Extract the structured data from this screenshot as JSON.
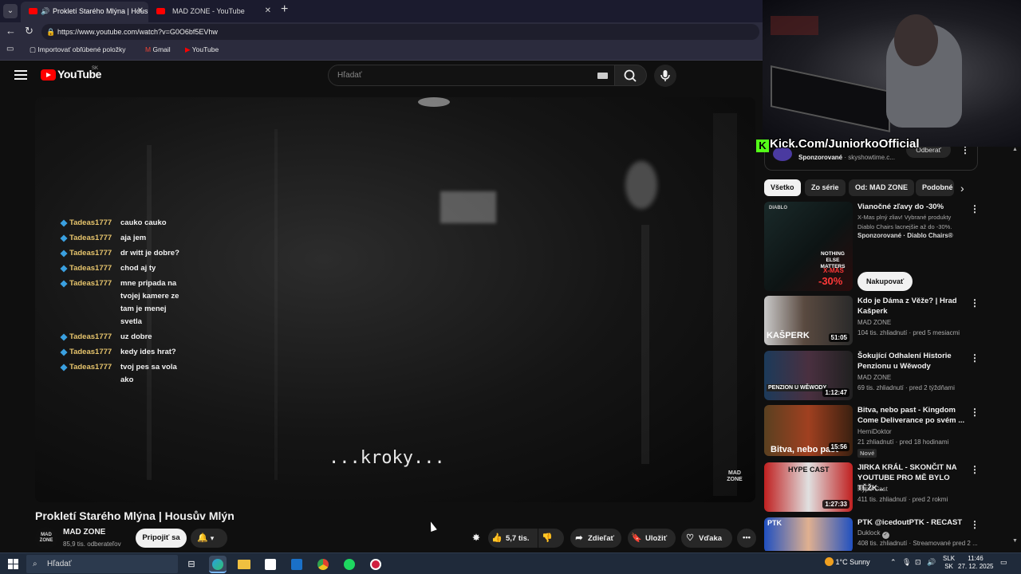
{
  "browser": {
    "tabs": [
      {
        "label": "Prokletí Starého Mlýna | Housů",
        "active": true
      },
      {
        "label": "MAD ZONE - YouTube",
        "active": false
      }
    ],
    "url": "https://www.youtube.com/watch?v=G0O6bf5EVhw",
    "bookmarks": [
      "Importovať obľúbené položky",
      "Gmail",
      "YouTube"
    ]
  },
  "youtube": {
    "logo": "YouTube",
    "region": "SK",
    "search_placeholder": "Hľadať"
  },
  "player": {
    "chat": [
      {
        "user": "Tadeas1777",
        "msg": "cauko cauko"
      },
      {
        "user": "Tadeas1777",
        "msg": "aja jem"
      },
      {
        "user": "Tadeas1777",
        "msg": "dr witt je dobre?"
      },
      {
        "user": "Tadeas1777",
        "msg": "chod aj ty"
      },
      {
        "user": "Tadeas1777",
        "msg": "mne pripada na tvojej kamere ze tam je menej svetla"
      },
      {
        "user": "Tadeas1777",
        "msg": "uz dobre"
      },
      {
        "user": "Tadeas1777",
        "msg": "kedy ides hrat?"
      },
      {
        "user": "Tadeas1777",
        "msg": "tvoj pes sa vola ako"
      }
    ],
    "subtitle": "...kroky...",
    "watermark": "MAD ZONE"
  },
  "video": {
    "title": "Prokletí Starého Mlýna | Housův Mlýn",
    "channel": "MAD ZONE",
    "channel_avatar": "MAD ZONE",
    "subscribers": "85,9 tis. odberateľov",
    "join_label": "Pripojiť sa",
    "likes": "5,7 tis.",
    "share_label": "Zdieľať",
    "save_label": "Uložiť",
    "thanks_label": "Vďaka"
  },
  "overlay": {
    "kick_text": "Kick.Com/JuniorkoOfficial",
    "sponsored": "Sponzorované",
    "sponsor_domain": "· skyshowtime.c...",
    "subscribe_label": "Odberať"
  },
  "chips": [
    "Všetko",
    "Zo série",
    "Od: MAD ZONE",
    "Podobné"
  ],
  "recommendations": [
    {
      "title": "Vianočné zľavy do -30%",
      "desc": "X-Mas plný zliav! Vybrané produkty Diablo Chairs lacnejšie až do -30%.",
      "meta": "Sponzorované · Diablo Chairs®",
      "cta": "Nakupovať",
      "thumb_texts": [
        "DIABLO",
        "NOTHING ELSE MATTERS",
        "X-MAS",
        "-30%"
      ],
      "ad": true
    },
    {
      "title": "Kdo je Dáma z Věže? | Hrad Kašperk",
      "channel": "MAD ZONE",
      "meta": "104 tis. zhliadnutí · pred 5 mesiacmi",
      "duration": "51:05",
      "thumb_text": "KAŠPERK"
    },
    {
      "title": "Šokující Odhalení Historie Penzionu u Wěwody",
      "channel": "MAD ZONE",
      "meta": "69 tis. zhliadnutí · pred 2 týždňami",
      "duration": "1:12:47",
      "thumb_text": "PENZION U WĚWODY"
    },
    {
      "title": "Bitva, nebo past - Kingdom Come Deliverance po svém ...",
      "channel": "HerniDoktor",
      "meta": "21 zhliadnutí · pred 18 hodinami",
      "duration": "15:56",
      "badge": "Nové",
      "thumb_text": "Bitva, nebo past"
    },
    {
      "title": "JIRKA KRÁL - SKONČIT NA YOUTUBE PRO MĚ BYLO TĚŽK...",
      "channel": "Hype-Cast",
      "meta": "411 tis. zhliadnutí · pred 2 rokmi",
      "duration": "1:27:33",
      "thumb_text": "HYPE CAST"
    },
    {
      "title": "PTK @icedoutPTK - RECAST",
      "channel": "Duklock",
      "meta": "408 tis. zhliadnutí · Streamované pred 2 ...",
      "thumb_text": "PTK"
    }
  ],
  "taskbar": {
    "search": "Hľadať",
    "weather": "1°C  Sunny",
    "lang_top": "SLK",
    "lang_bottom": "SK",
    "time": "11:46",
    "date": "27. 12. 2025"
  },
  "colors": {
    "youtube_red": "#ff0000",
    "kick_green": "#53fc18",
    "chat_user": "#e6c46c"
  }
}
